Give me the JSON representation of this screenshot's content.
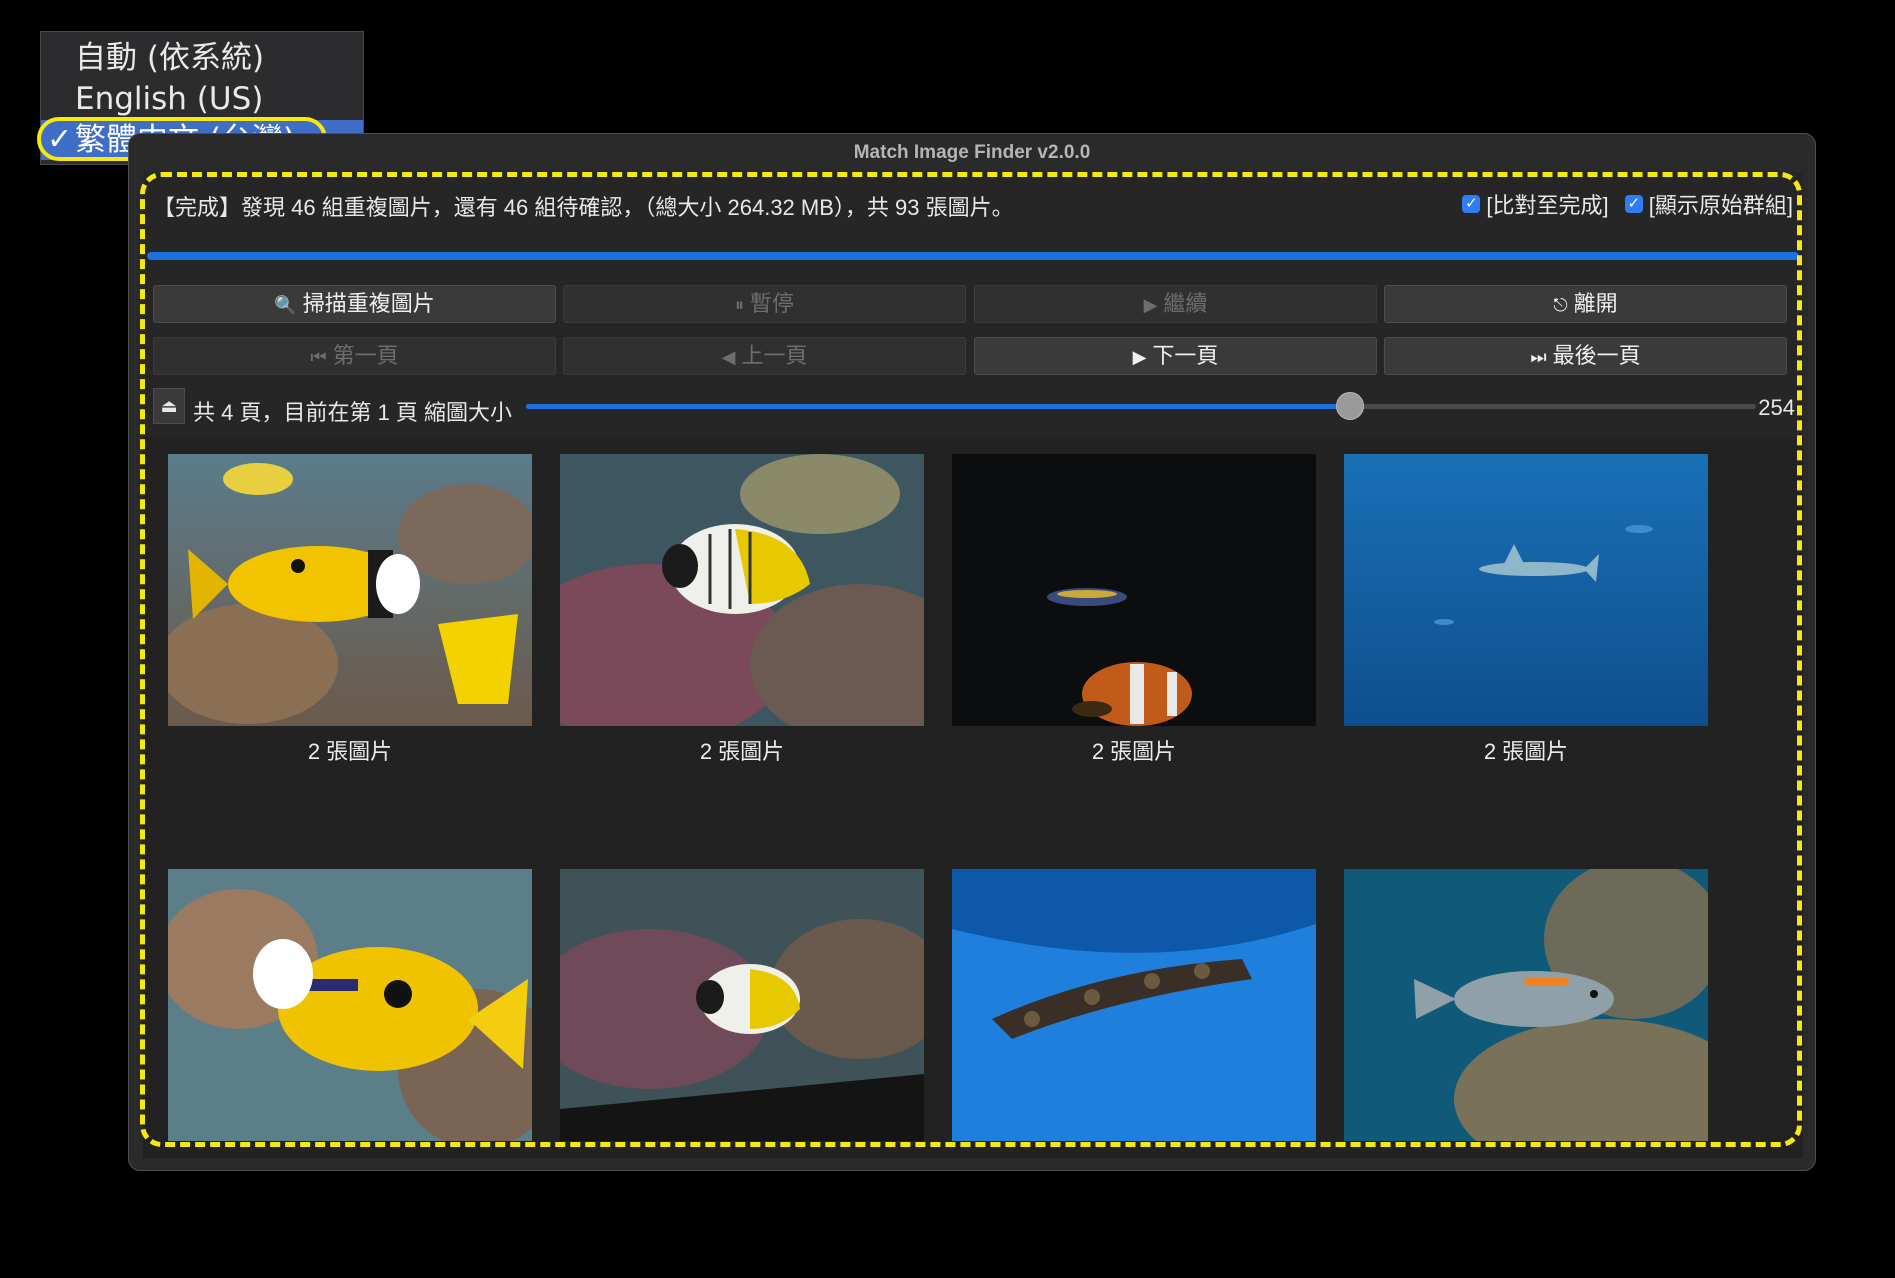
{
  "language_menu": {
    "items": [
      {
        "label": "自動 (依系統)",
        "checked": false
      },
      {
        "label": "English (US)",
        "checked": false
      },
      {
        "label": "繁體中文 (台灣)",
        "checked": true
      }
    ],
    "check_mark": "✓"
  },
  "window": {
    "title": "Match Image Finder v2.0.0"
  },
  "status": {
    "text": "【完成】發現 46 組重複圖片，還有 46 組待確認，（總大小 264.32 MB），共 93 張圖片。",
    "progress": 1.0
  },
  "options": {
    "compare_to_end": "[比對至完成]",
    "show_original_group": "[顯示原始群組]"
  },
  "toolbar": {
    "scan_label": "掃描重複圖片",
    "pause_label": "暫停",
    "continue_label": "繼續",
    "exit_label": "離開"
  },
  "paging": {
    "first_label": "第一頁",
    "prev_label": "上一頁",
    "next_label": "下一頁",
    "last_label": "最後一頁",
    "info": "共 4 頁，目前在第 1 頁 縮圖大小",
    "thumbnail_size": "254",
    "slider_fraction": 0.67
  },
  "thumbnails": [
    {
      "caption": "2 張圖片",
      "icon": "yellow-rabbitfish-photo"
    },
    {
      "caption": "2 張圖片",
      "icon": "threadfin-butterflyfish-photo"
    },
    {
      "caption": "2 張圖片",
      "icon": "dark-tank-clownfish-photo"
    },
    {
      "caption": "2 張圖片",
      "icon": "shark-blue-water-photo"
    },
    {
      "caption": "",
      "icon": "rabbitfish-closeup-photo"
    },
    {
      "caption": "",
      "icon": "butterflyfish-coral-photo"
    },
    {
      "caption": "",
      "icon": "bamboo-shark-photo"
    },
    {
      "caption": "",
      "icon": "surgeonfish-reef-photo"
    }
  ],
  "colors": {
    "accent": "#1f6fe0",
    "highlight": "#f5e911",
    "menu_selected": "#3f6ec6"
  }
}
